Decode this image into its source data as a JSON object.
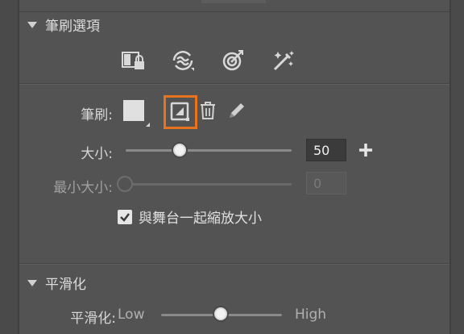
{
  "brush_options": {
    "title": "筆刷選項",
    "tool_icons": [
      "lock-fill-icon",
      "stroke-smoothing-icon",
      "pressure-target-icon",
      "magic-wand-icon"
    ]
  },
  "brush": {
    "label": "筆刷:",
    "swatch_color": "#e0e0e0",
    "highlight_color": "#e8731f"
  },
  "size": {
    "label": "大小:",
    "value": "50",
    "slider_fraction": 0.33
  },
  "min_size": {
    "label": "最小大小:",
    "value": "0",
    "slider_fraction": 0.0
  },
  "scale_with_stage": {
    "label": "與舞台一起縮放大小",
    "checked": true
  },
  "smoothing": {
    "title": "平滑化",
    "label": "平滑化:",
    "low": "Low",
    "high": "High",
    "slider_fraction": 0.5
  }
}
